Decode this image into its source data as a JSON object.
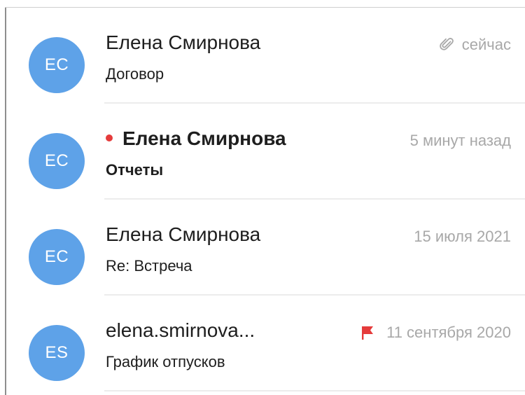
{
  "colors": {
    "avatar_bg": "#5ea2e8",
    "unread_dot": "#e53b3b",
    "flag": "#e53b3b",
    "meta_text": "#a8a8a8"
  },
  "messages": [
    {
      "avatar_initials": "ЕС",
      "sender": "Елена Смирнова",
      "subject": "Договор",
      "time": "сейчас",
      "unread": false,
      "has_attachment": true,
      "flagged": false,
      "icon": "paperclip-icon"
    },
    {
      "avatar_initials": "ЕС",
      "sender": "Елена Смирнова",
      "subject": "Отчеты",
      "time": "5 минут назад",
      "unread": true,
      "has_attachment": false,
      "flagged": false,
      "icon": "unread-dot-icon"
    },
    {
      "avatar_initials": "ЕС",
      "sender": "Елена Смирнова",
      "subject": "Re: Встреча",
      "time": "15 июля 2021",
      "unread": false,
      "has_attachment": false,
      "flagged": false,
      "icon": ""
    },
    {
      "avatar_initials": "ES",
      "sender": "elena.smirnova...",
      "subject": "График отпусков",
      "time": "11 сентября 2020",
      "unread": false,
      "has_attachment": false,
      "flagged": true,
      "icon": "flag-icon"
    }
  ]
}
